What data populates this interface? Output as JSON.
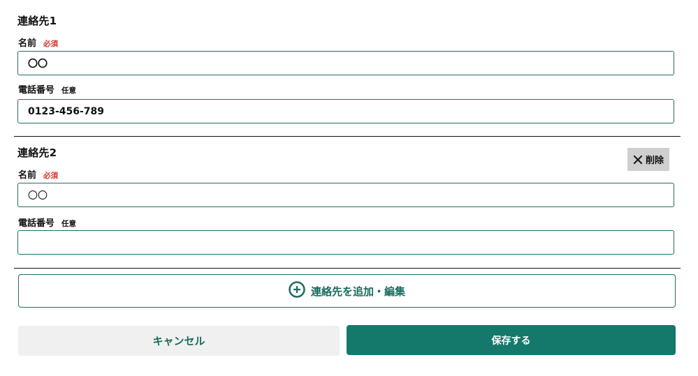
{
  "contacts": [
    {
      "title": "連絡先1",
      "name_label": "名前",
      "name_badge": "必須",
      "name_value": "〇〇",
      "phone_label": "電話番号",
      "phone_badge": "任意",
      "phone_value": "0123-456-789"
    },
    {
      "title": "連絡先2",
      "delete_label": "削除",
      "name_label": "名前",
      "name_badge": "必須",
      "name_value": "〇〇",
      "phone_label": "電話番号",
      "phone_badge": "任意",
      "phone_value": ""
    }
  ],
  "actions": {
    "add_label": "連絡先を追加・編集",
    "cancel_label": "キャンセル",
    "save_label": "保存する"
  },
  "colors": {
    "accent": "#14786a",
    "required": "#d9322e",
    "border": "#1f6f62"
  },
  "icons": {
    "delete": "close-icon",
    "add": "plus-circle-icon"
  }
}
